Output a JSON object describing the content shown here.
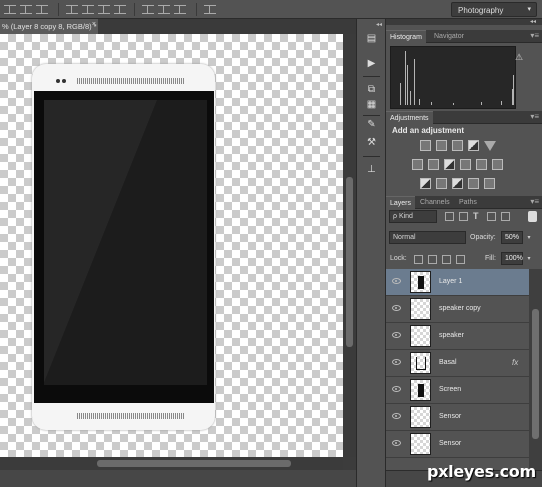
{
  "workspace": {
    "label": "Photography",
    "arrow": "▾"
  },
  "document": {
    "tab_title": "(Layer 8 copy 8, RGB/8) *",
    "tab_prefix": "%",
    "close": "×"
  },
  "icon_strip": {
    "collapse": "◂◂",
    "buttons": [
      {
        "icon": "history-icon",
        "glyph": "▤"
      },
      {
        "icon": "actions-icon",
        "glyph": "▶"
      },
      {
        "icon": "clone-source-icon",
        "glyph": "⧉"
      },
      {
        "icon": "properties-icon",
        "glyph": "▦"
      },
      {
        "icon": "brush-icon",
        "glyph": "✎"
      },
      {
        "icon": "tool-presets-icon",
        "glyph": "⚒"
      },
      {
        "icon": "character-icon",
        "glyph": "⊥"
      }
    ]
  },
  "histogram_panel": {
    "tabs": [
      "Histogram",
      "Navigator"
    ],
    "menu": "▾≡",
    "warning": "⚠",
    "collapse": "◂◂"
  },
  "adjustments_panel": {
    "tab": "Adjustments",
    "menu": "▾≡",
    "title": "Add an adjustment"
  },
  "layers_panel": {
    "tabs": [
      "Layers",
      "Channels",
      "Paths"
    ],
    "menu": "▾≡",
    "kind_label": "Kind",
    "kind_prefix": "ρ",
    "filter_type_glyph": "T",
    "blend_mode": "Normal",
    "opacity_label": "Opacity:",
    "opacity_value": "50%",
    "lock_label": "Lock:",
    "fill_label": "Fill:",
    "fill_value": "100%",
    "layers": [
      {
        "name": "Layer 1",
        "selected": true,
        "thumb": "phone-object",
        "fx": ""
      },
      {
        "name": "speaker copy",
        "selected": false,
        "thumb": "empty",
        "fx": ""
      },
      {
        "name": "speaker",
        "selected": false,
        "thumb": "empty",
        "fx": ""
      },
      {
        "name": "Basal",
        "selected": false,
        "thumb": "outline-object",
        "fx": "fx"
      },
      {
        "name": "Screen",
        "selected": false,
        "thumb": "phone-object",
        "fx": ""
      },
      {
        "name": "Sensor",
        "selected": false,
        "thumb": "empty",
        "fx": ""
      },
      {
        "name": "Sensor",
        "selected": false,
        "thumb": "empty",
        "fx": ""
      }
    ]
  },
  "watermark": "pxleyes.com",
  "colors": {
    "panel": "#535353",
    "selected_layer": "#6b7c8f",
    "canvas_check": "#cbcbcb"
  }
}
